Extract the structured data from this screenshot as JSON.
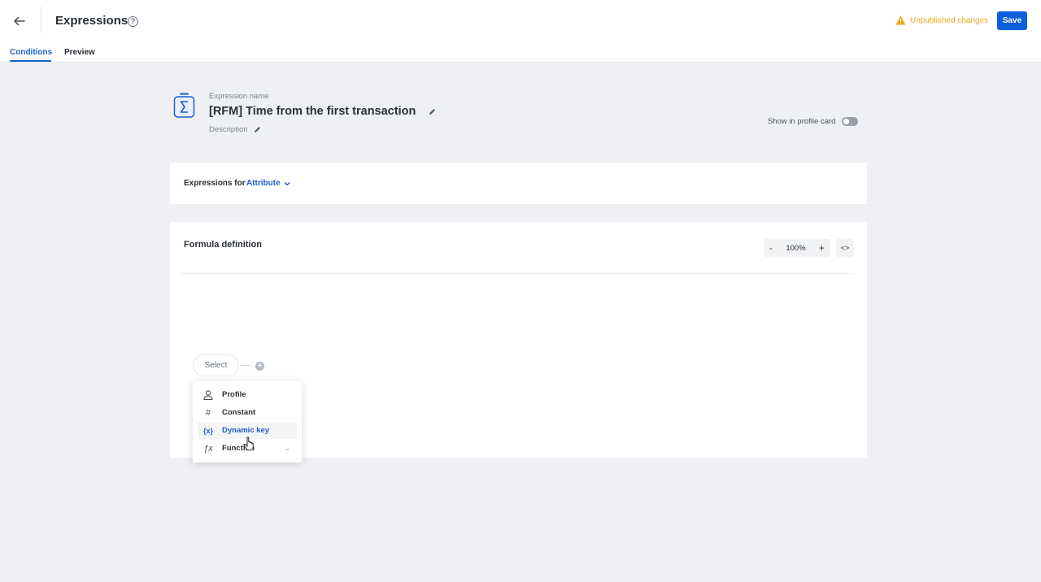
{
  "header": {
    "title": "Expressions",
    "help_icon": "?",
    "unpublished": "Unpublished changes",
    "save": "Save",
    "tabs": [
      {
        "label": "Conditions",
        "active": true
      },
      {
        "label": "Preview",
        "active": false
      }
    ]
  },
  "expression": {
    "name_label": "Expression name",
    "name": "[RFM] Time from the first transaction",
    "description_label": "Description",
    "show_profile_card_label": "Show in profile card",
    "show_profile_card": false
  },
  "expressions_for": {
    "label": "Expressions for",
    "value": "Attribute"
  },
  "formula": {
    "title": "Formula definition",
    "zoom": "100%",
    "zoom_out": "-",
    "zoom_in": "+",
    "code_icon": "<>",
    "select_label": "Select",
    "plus_icon": "+"
  },
  "menu": {
    "items": [
      {
        "label": "Profile",
        "icon": "user-icon"
      },
      {
        "label": "Constant",
        "icon": "hash-icon"
      },
      {
        "label": "Dynamic key",
        "icon": "variable-icon"
      },
      {
        "label": "Function",
        "icon": "fx-icon"
      }
    ]
  },
  "icon_glyphs": {
    "hash": "#",
    "variable": "{x}",
    "fx": "ƒx",
    "chevron": "⌄"
  },
  "colors": {
    "accent": "#1f5fc9",
    "save_bg": "#0b5fdb",
    "warning": "#f0a81a",
    "background": "#eef0f3"
  }
}
